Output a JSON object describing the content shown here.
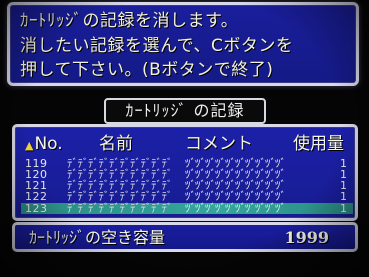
{
  "message": {
    "line1": "ｶｰﾄﾘｯｼﾞの記録を消します。",
    "line2": "消したい記録を選んで、Cボタンを",
    "line3": "押して下さい。(Bボタンで終了)"
  },
  "panel_title": "ｶｰﾄﾘｯｼﾞ の記録",
  "headers": {
    "sort_icon": "triangle-icon",
    "no": "No.",
    "name": "名前",
    "comment": "コメント",
    "usage": "使用量"
  },
  "rows": [
    {
      "no": "119",
      "name": "ﾃﾞﾃﾞﾃﾞﾃﾞﾃﾞﾃﾞﾃﾞﾃﾞﾃﾞﾃﾞ",
      "comment": "ﾂﾞﾂﾞﾂﾞﾂﾞﾂﾞﾂﾞﾂﾞﾂﾞﾂﾞﾂﾞ",
      "usage": "1"
    },
    {
      "no": "120",
      "name": "ﾃﾞﾃﾞﾃﾞﾃﾞﾃﾞﾃﾞﾃﾞﾃﾞﾃﾞﾃﾞ",
      "comment": "ﾂﾞﾂﾞﾂﾞﾂﾞﾂﾞﾂﾞﾂﾞﾂﾞﾂﾞﾂﾞ",
      "usage": "1"
    },
    {
      "no": "121",
      "name": "ﾃﾞﾃﾞﾃﾞﾃﾞﾃﾞﾃﾞﾃﾞﾃﾞﾃﾞﾃﾞ",
      "comment": "ﾂﾞﾂﾞﾂﾞﾂﾞﾂﾞﾂﾞﾂﾞﾂﾞﾂﾞﾂﾞ",
      "usage": "1"
    },
    {
      "no": "122",
      "name": "ﾃﾞﾃﾞﾃﾞﾃﾞﾃﾞﾃﾞﾃﾞﾃﾞﾃﾞﾃﾞ",
      "comment": "ﾂﾞﾂﾞﾂﾞﾂﾞﾂﾞﾂﾞﾂﾞﾂﾞﾂﾞﾂﾞ",
      "usage": "1"
    },
    {
      "no": "123",
      "name": "ﾃﾞﾃﾞﾃﾞﾃﾞﾃﾞﾃﾞﾃﾞﾃﾞﾃﾞﾃﾞ",
      "comment": "ﾂﾞﾂﾞﾂﾞﾂﾞﾂﾞﾂﾞﾂﾞﾂﾞﾂﾞﾂﾞ",
      "usage": "1"
    }
  ],
  "capacity": {
    "label": "ｶｰﾄﾘｯｼﾞの空き容量",
    "value": "1999"
  },
  "colors": {
    "window_blue": "#1a1e9c",
    "border": "#d8d8e8",
    "text": "#f2f2d8",
    "selection": "#33a89c",
    "sort_marker": "#f0d040"
  }
}
